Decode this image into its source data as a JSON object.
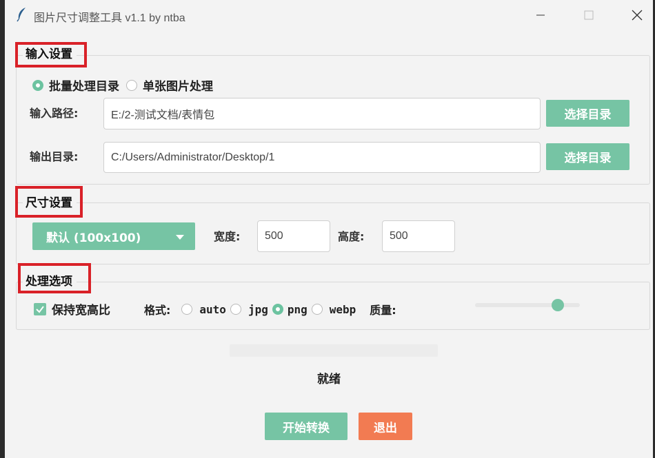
{
  "window": {
    "title": "图片尺寸调整工具 v1.1 by ntba",
    "icons": {
      "app": "feather-icon",
      "minimize": "minimize-icon",
      "maximize": "maximize-icon",
      "close": "close-icon"
    }
  },
  "colors": {
    "accent": "#76c4a4",
    "danger": "#f27b52",
    "highlight_border": "#d92128"
  },
  "input_section": {
    "title": "输入设置",
    "modes": [
      {
        "label": "批量处理目录",
        "selected": true
      },
      {
        "label": "单张图片处理",
        "selected": false
      }
    ],
    "input_path": {
      "label": "输入路径:",
      "value": "E:/2-测试文档/表情包",
      "button": "选择目录"
    },
    "output_dir": {
      "label": "输出目录:",
      "value": "C:/Users/Administrator/Desktop/1",
      "button": "选择目录"
    }
  },
  "size_section": {
    "title": "尺寸设置",
    "preset": "默认 (100x100)",
    "width_label": "宽度:",
    "width_value": "500",
    "height_label": "高度:",
    "height_value": "500"
  },
  "options_section": {
    "title": "处理选项",
    "keep_ratio": {
      "label": "保持宽高比",
      "checked": true
    },
    "format_label": "格式:",
    "formats": [
      {
        "label": "auto",
        "selected": false
      },
      {
        "label": "jpg",
        "selected": false
      },
      {
        "label": "png",
        "selected": true
      },
      {
        "label": "webp",
        "selected": false
      }
    ],
    "quality_label": "质量:",
    "quality_value": 0.83
  },
  "progress": {
    "value": 0
  },
  "status": "就绪",
  "actions": {
    "start": "开始转换",
    "exit": "退出"
  }
}
